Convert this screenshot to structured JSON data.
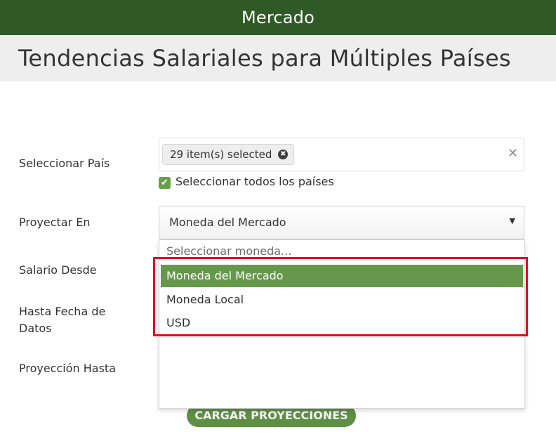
{
  "header": {
    "app_title": "Mercado"
  },
  "page": {
    "title": "Tendencias Salariales para Múltiples Países"
  },
  "form": {
    "country_label": "Seleccionar País",
    "country_chip": "29 item(s) selected",
    "chip_remove_glyph": "✖",
    "clear_glyph": "✕",
    "select_all_checked": true,
    "select_all_check_glyph": "✔",
    "select_all_label": "Seleccionar todos los países",
    "project_label": "Proyectar En",
    "project_value": "Moneda del Mercado",
    "caret_glyph": "▼",
    "salary_from_label": "Salario Desde",
    "data_date_label": "Hasta Fecha de Datos",
    "projection_label": "Proyección Hasta",
    "load_button": "CARGAR PROYECCIONES"
  },
  "dropdown": {
    "placeholder": "Seleccionar moneda...",
    "options": [
      "Moneda del Mercado",
      "Moneda Local",
      "USD"
    ],
    "active_index": 0
  },
  "colors": {
    "header_bg": "#2f5a26",
    "accent_green": "#65984a",
    "highlight_red": "#e0101e"
  }
}
